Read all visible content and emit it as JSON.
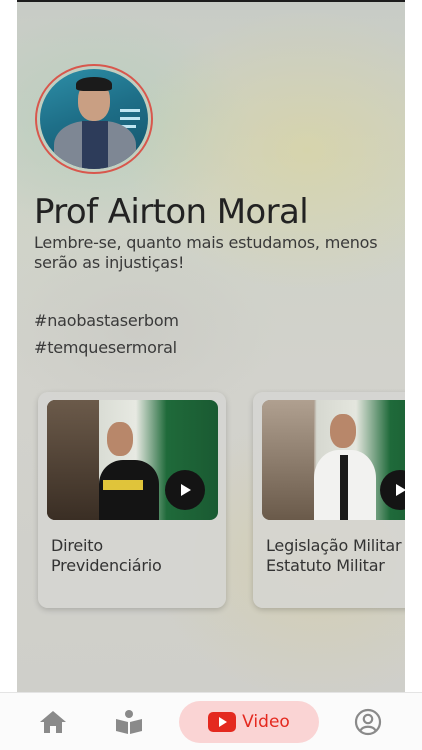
{
  "profile": {
    "name": "Prof Airton Moral",
    "motto": "Lembre-se, quanto mais estudamos, menos serão as injustiças!",
    "hashtags": [
      "#naobastaserbom",
      "#temquesermoral"
    ]
  },
  "videos": [
    {
      "title_line1": "Direito",
      "title_line2": "Previdenciário"
    },
    {
      "title_line1": "Legislação Militar",
      "title_line2": "Estatuto Militar"
    }
  ],
  "nav": {
    "items": [
      {
        "icon": "home-icon"
      },
      {
        "icon": "book-icon"
      },
      {
        "icon": "youtube-icon",
        "label": "Video"
      },
      {
        "icon": "profile-icon"
      }
    ],
    "active_color": "#e4291f",
    "active_bg": "#fad4d4"
  }
}
